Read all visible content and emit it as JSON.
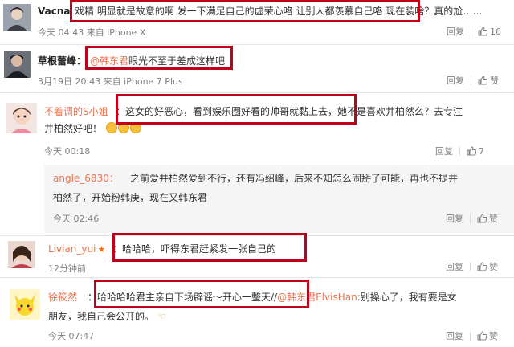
{
  "comments": [
    {
      "user": "Vacna",
      "text": "戏精 明显就是故意的啊 发一下满足自己的虚荣心咯 让别人都羡慕自己咯 现在装啥？真的尬……",
      "time": "今天 04:43 来自 iPhone X",
      "reply": "回复",
      "likes": "16"
    },
    {
      "user": "草根蕾峰：",
      "mention": "@韩东君",
      "text": "眼光不至于差成这样吧",
      "time": "3月19日 20:43 来自 iPhone 7 Plus",
      "reply": "回复",
      "likes": "赞"
    },
    {
      "user": "不着调的S小姐",
      "text_line1": "：这女的好恶心，看到娱乐圈好看的帅哥就黏上去，她不是喜欢井柏然么？去专注",
      "text_line2": "井柏然好吧！",
      "time": "今天 00:18",
      "reply": "回复",
      "likes": "7"
    },
    {
      "user": "angle_6830：",
      "text_line1": "之前爱井柏然爱到不行，还有冯绍峰，后来不知怎么闹掰了可能，再也不提井",
      "text_line2": "柏然了，开始粉韩庚，现在又韩东君",
      "time": "今天 02:46",
      "reply": "回复",
      "likes": "赞"
    },
    {
      "user": "Livian_yui",
      "text": "：哈哈哈，吓得东君赶紧发一张自己的",
      "time": "12分钟前",
      "reply": "回复",
      "likes": "赞"
    },
    {
      "user": "徐筱然",
      "text_line1": "：哈哈哈哈君主亲自下场辟谣～开心一整天//",
      "mention": "@韩东君ElvisHan",
      "text_line1b": ":别操心了，我有要是女",
      "text_line2": "朋友，我自己会公开的。",
      "time": "今天 07:47",
      "reply": "回复",
      "likes": "赞"
    }
  ]
}
